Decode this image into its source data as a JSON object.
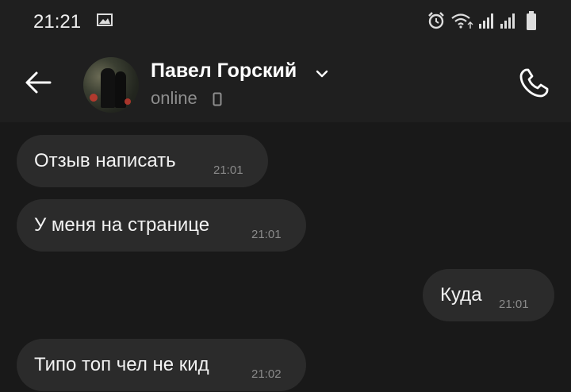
{
  "status_bar": {
    "time": "21:21"
  },
  "header": {
    "contact_name": "Павел Горский",
    "status": "online"
  },
  "messages": [
    {
      "text": "Отзыв написать",
      "time": "21:01",
      "direction": "incoming"
    },
    {
      "text": "У меня на странице",
      "time": "21:01",
      "direction": "incoming"
    },
    {
      "text": "Куда",
      "time": "21:01",
      "direction": "outgoing"
    },
    {
      "text": "Типо топ чел не кид",
      "time": "21:02",
      "direction": "incoming"
    }
  ],
  "colors": {
    "background": "#191919",
    "header": "#1f1f1f",
    "bubble": "#2b2b2b",
    "text": "#f2f2f2",
    "muted": "#8a8a8a"
  },
  "icons": [
    "gallery-icon",
    "alarm-icon",
    "wifi-icon",
    "signal-icon",
    "battery-icon",
    "back-arrow-icon",
    "chevron-down-icon",
    "phone-icon",
    "call-icon"
  ]
}
